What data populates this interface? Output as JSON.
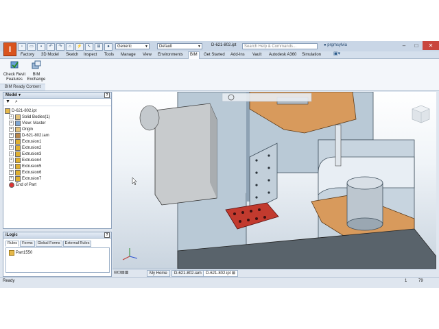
{
  "app": {
    "logo_letter": "I",
    "document_title": "D-621-802.ipt",
    "search_placeholder": "Search Help & Commands...",
    "user_label": "prgmsylvia",
    "material_combo": "Generic",
    "appearance_combo": "Default"
  },
  "ribbon_tabs": [
    "Factory",
    "3D Model",
    "Sketch",
    "Inspect",
    "Tools",
    "Manage",
    "View",
    "Environments",
    "BIM",
    "Get Started",
    "Add-Ins",
    "Vault",
    "Autodesk A360",
    "Simulation"
  ],
  "ribbon_active_tab": "BIM",
  "ribbon": {
    "buttons": [
      {
        "label1": "Check Revit",
        "label2": "Features"
      },
      {
        "label1": "BIM",
        "label2": "Exchange"
      }
    ],
    "panel_label": "BIM Ready Content"
  },
  "browser": {
    "title": "Model",
    "tree": [
      {
        "label": "D-621-802.ipt",
        "level": 0,
        "expander": ""
      },
      {
        "label": "Solid Bodies(1)",
        "level": 1,
        "expander": "+"
      },
      {
        "label": "View: Master",
        "level": 1,
        "expander": "+"
      },
      {
        "label": "Origin",
        "level": 1,
        "expander": "+"
      },
      {
        "label": "D-621-802.iam",
        "level": 1,
        "expander": "+"
      },
      {
        "label": "Extrusion1",
        "level": 1,
        "expander": "+"
      },
      {
        "label": "Extrusion2",
        "level": 1,
        "expander": "+"
      },
      {
        "label": "Extrusion3",
        "level": 1,
        "expander": "+"
      },
      {
        "label": "Extrusion4",
        "level": 1,
        "expander": "+"
      },
      {
        "label": "Extrusion5",
        "level": 1,
        "expander": "+"
      },
      {
        "label": "Extrusion6",
        "level": 1,
        "expander": "+"
      },
      {
        "label": "Extrusion7",
        "level": 1,
        "expander": "+"
      },
      {
        "label": "End of Part",
        "level": 1,
        "expander": ""
      }
    ]
  },
  "ilogic": {
    "title": "iLogic",
    "tabs": [
      "Rules",
      "Forms",
      "Global Forms",
      "External Rules"
    ],
    "active_tab": "Rules",
    "rules": [
      "Part1550"
    ]
  },
  "doc_tabs": [
    "My Home",
    "D-621-802.iam",
    "D-621-802.ipt"
  ],
  "doc_active": "D-621-802.ipt",
  "status": {
    "left": "Ready",
    "count1": "1",
    "count2": "79"
  },
  "colors": {
    "accent": "#d9541e",
    "part_blue": "#b9c9d6",
    "part_orange": "#d89a5c",
    "part_red": "#c23a2e"
  }
}
